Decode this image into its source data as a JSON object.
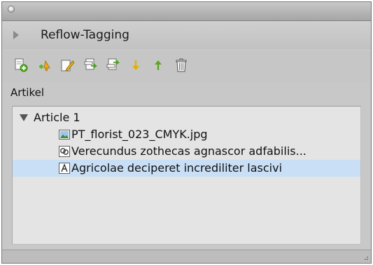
{
  "panel": {
    "title": "Reflow-Tagging",
    "section_label": "Artikel"
  },
  "toolbar": {
    "buttons": [
      {
        "name": "new-article-button",
        "icon": "new-article-icon"
      },
      {
        "name": "add-item-button",
        "icon": "add-item-icon"
      },
      {
        "name": "edit-item-button",
        "icon": "edit-item-icon"
      },
      {
        "name": "tag-item-button",
        "icon": "tag-item-icon"
      },
      {
        "name": "tag-item-alt-button",
        "icon": "tag-item-alt-icon"
      },
      {
        "name": "move-down-button",
        "icon": "arrow-down-icon"
      },
      {
        "name": "move-up-button",
        "icon": "arrow-up-icon"
      },
      {
        "name": "delete-button",
        "icon": "trash-icon"
      }
    ]
  },
  "tree": {
    "article": {
      "label": "Article 1",
      "expanded": true
    },
    "items": [
      {
        "label": "PT_florist_023_CMYK.jpg",
        "icon": "image-icon",
        "selected": false
      },
      {
        "label": "Verecundus zothecas agnascor adfabilis...",
        "icon": "linked-text-icon",
        "selected": false
      },
      {
        "label": "Agricolae deciperet incrediliter lascivi",
        "icon": "text-frame-icon",
        "selected": true
      }
    ]
  },
  "colors": {
    "panel_bg": "#c8c8c8",
    "tree_bg": "#e4e4e4",
    "selection": "#c8dff5",
    "arrow_green": "#5aa81f",
    "arrow_yellow": "#e5b400"
  }
}
